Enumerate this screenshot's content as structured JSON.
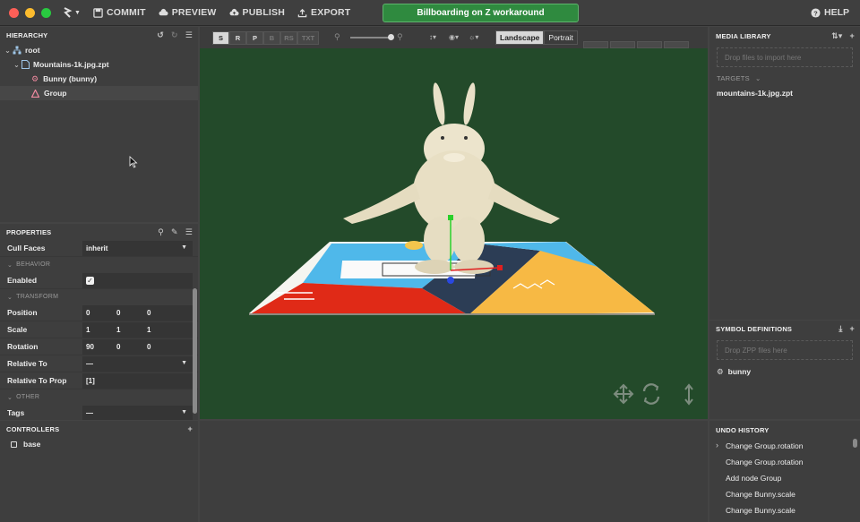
{
  "toolbar": {
    "commit": "COMMIT",
    "preview": "PREVIEW",
    "publish": "PUBLISH",
    "export": "EXPORT",
    "notice": "Billboarding on Z workaround",
    "help": "HELP"
  },
  "hierarchy": {
    "title": "HIERARCHY",
    "items": [
      {
        "label": "root",
        "icon": "tree-icon"
      },
      {
        "label": "Mountains-1k.jpg.zpt",
        "icon": "file-icon"
      },
      {
        "label": "Bunny (bunny)",
        "icon": "gear-icon"
      },
      {
        "label": "Group",
        "icon": "group-icon"
      }
    ]
  },
  "properties": {
    "title": "PROPERTIES",
    "cull_faces": {
      "label": "Cull Faces",
      "value": "inherit"
    },
    "section_behavior": "BEHAVIOR",
    "enabled": {
      "label": "Enabled",
      "checked": true
    },
    "section_transform": "TRANSFORM",
    "position": {
      "label": "Position",
      "values": [
        "0",
        "0",
        "0"
      ]
    },
    "scale": {
      "label": "Scale",
      "values": [
        "1",
        "1",
        "1"
      ]
    },
    "rotation": {
      "label": "Rotation",
      "values": [
        "90",
        "0",
        "0"
      ]
    },
    "relative_to": {
      "label": "Relative To",
      "value": "—"
    },
    "relative_to_prop": {
      "label": "Relative To Prop",
      "value": "[1]"
    },
    "section_other": "OTHER",
    "tags": {
      "label": "Tags",
      "value": "—"
    }
  },
  "controllers": {
    "title": "CONTROLLERS",
    "items": [
      "base"
    ]
  },
  "viewport": {
    "modes": [
      "S",
      "R",
      "P",
      "B",
      "RS",
      "TXT"
    ],
    "active_mode": "S",
    "orientation": [
      "Landscape",
      "Portrait"
    ],
    "active_orientation": "Landscape",
    "background": "#234a2a"
  },
  "media_library": {
    "title": "MEDIA LIBRARY",
    "drop_hint": "Drop files to import here",
    "targets_label": "TARGETS",
    "targets": [
      "mountains-1k.jpg.zpt"
    ]
  },
  "symbol_definitions": {
    "title": "SYMBOL DEFINITIONS",
    "drop_hint": "Drop ZPP files here",
    "items": [
      "bunny"
    ]
  },
  "undo_history": {
    "title": "UNDO HISTORY",
    "items": [
      "Change Group.rotation",
      "Change Group.rotation",
      "Add node Group",
      "Change Bunny.scale",
      "Change Bunny.scale"
    ]
  },
  "colors": {
    "accent_green": "#2f8a3f",
    "viewport_green": "#234a2a"
  }
}
